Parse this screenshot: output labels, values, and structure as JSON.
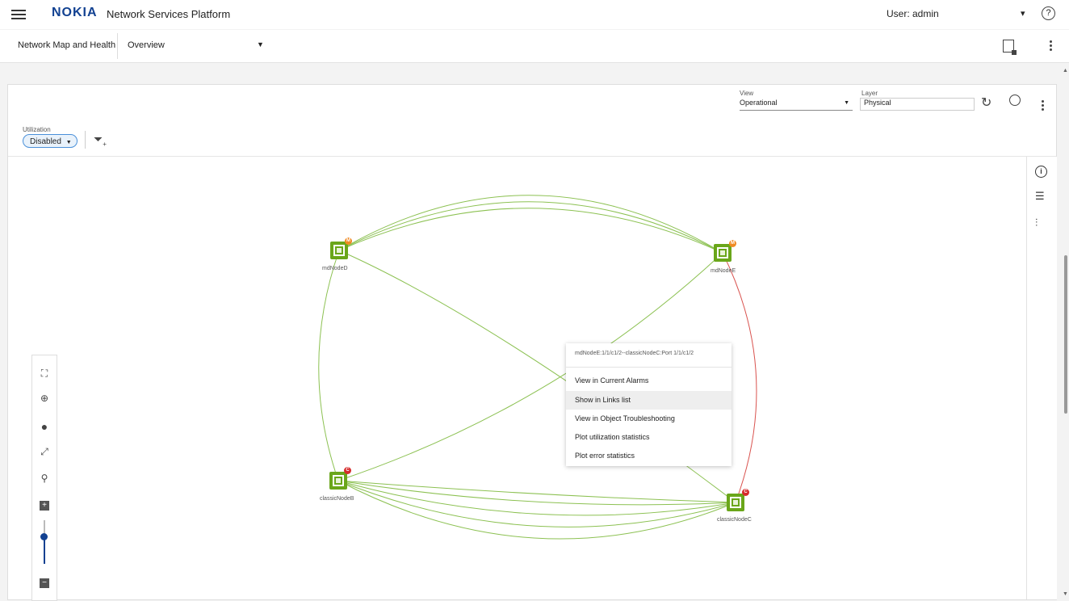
{
  "header": {
    "logo": "NOKIA",
    "app_title": "Network Services Platform",
    "user_label": "User: admin",
    "help_icon": "help-circle-icon"
  },
  "subheader": {
    "breadcrumb": "Network Map and Health",
    "view_selected": "Overview"
  },
  "toolbar": {
    "view_label": "View",
    "view_value": "Operational",
    "layer_label": "Layer",
    "layer_value": "Physical",
    "utilization_label": "Utilization",
    "utilization_value": "Disabled"
  },
  "nodes": [
    {
      "label": "mdNodeD",
      "badge": "M"
    },
    {
      "label": "mdNodeE",
      "badge": "M"
    },
    {
      "label": "classicNodeB",
      "badge": "C"
    },
    {
      "label": "classicNodeC",
      "badge": "C"
    }
  ],
  "link_colors": {
    "normal": "#8cc152",
    "alarm": "#d9534f"
  },
  "context_menu": {
    "title": "mdNodeE:1/1/c1/2--classicNodeC:Port 1/1/c1/2",
    "items": [
      "View in Current Alarms",
      "Show in Links list",
      "View in Object Troubleshooting",
      "Plot utilization statistics",
      "Plot error statistics"
    ],
    "highlighted_index": 1
  },
  "zoom_controls": {
    "zoom_in": "+",
    "zoom_out": "−",
    "zoom_level": 0.35
  }
}
